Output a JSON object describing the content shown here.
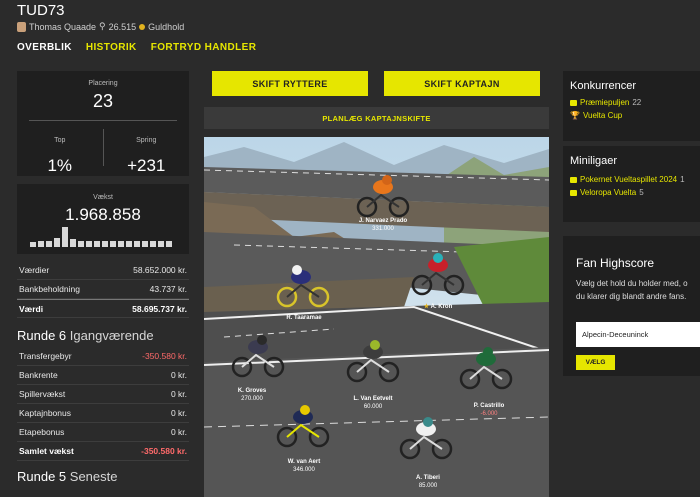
{
  "header": {
    "team_name": "TUD73",
    "manager": "Thomas Quaade",
    "points": "26.515",
    "league": "Guldhold"
  },
  "nav": {
    "items": [
      {
        "label": "OVERBLIK",
        "active": false
      },
      {
        "label": "HISTORIK",
        "active": true
      },
      {
        "label": "FORTRYD HANDLER",
        "active": true
      }
    ]
  },
  "stats": {
    "placering_label": "Placering",
    "placering": "23",
    "top_label": "Top",
    "top": "1%",
    "spring_label": "Spring",
    "spring": "+231",
    "vaekst_label": "Vækst",
    "vaekst": "1.968.858"
  },
  "values": [
    {
      "label": "Værdier",
      "value": "58.652.000 kr."
    },
    {
      "label": "Bankbeholdning",
      "value": "43.737 kr."
    },
    {
      "label": "Værdi",
      "value": "58.695.737 kr."
    }
  ],
  "round6": {
    "num": "Runde 6",
    "status": "Igangværende",
    "rows": [
      {
        "label": "Transfergebyr",
        "value": "-350.580 kr."
      },
      {
        "label": "Bankrente",
        "value": "0 kr."
      },
      {
        "label": "Spillervækst",
        "value": "0 kr."
      },
      {
        "label": "Kaptajnbonus",
        "value": "0 kr."
      },
      {
        "label": "Etapebonus",
        "value": "0 kr."
      },
      {
        "label": "Samlet vækst",
        "value": "-350.580 kr."
      }
    ]
  },
  "round5": {
    "num": "Runde 5",
    "status": "Seneste"
  },
  "actions": {
    "skift_ryttere": "SKIFT RYTTERE",
    "skift_kaptajn": "SKIFT KAPTAJN",
    "plan": "PLANLÆG KAPTAJNSKIFTE"
  },
  "riders": [
    {
      "name": "J. Narvaez Prado",
      "value": "331.000",
      "jersey": "#e8761c"
    },
    {
      "name": "R. Taaramae",
      "value": "",
      "jersey": "#2a2f7a"
    },
    {
      "name": "A. Kron",
      "value": "",
      "jersey": "#c8202a"
    },
    {
      "name": "K. Groves",
      "value": "270.000",
      "jersey": "#3b3b50"
    },
    {
      "name": "L. Van Eetvelt",
      "value": "60.000",
      "jersey": "#3d3d3d"
    },
    {
      "name": "P. Castrillo",
      "value": "-6.000",
      "jersey": "#1f6b3a"
    },
    {
      "name": "W. van Aert",
      "value": "346.000",
      "jersey": "#1f2a55"
    },
    {
      "name": "A. Tiberi",
      "value": "85.000",
      "jersey": "#f0f0f0"
    }
  ],
  "konkurrencer": {
    "title": "Konkurrencer",
    "items": [
      {
        "label": "Præmiepuljen",
        "count": "22"
      },
      {
        "label": "Vuelta Cup",
        "count": ""
      }
    ]
  },
  "miniligaer": {
    "title": "Miniligaer",
    "items": [
      {
        "label": "Pokernet Vueltaspillet 2024",
        "count": "1"
      },
      {
        "label": "Veloropa Vuelta",
        "count": "5"
      }
    ]
  },
  "fan": {
    "title": "Fan Highscore",
    "text1": "Vælg det hold du holder med, o",
    "text2": "du klarer dig blandt andre fans.",
    "selected": "Alpecin-Deceuninck",
    "button": "VÆLG"
  },
  "colors": {
    "accent": "#e6e600",
    "negative": "#ff6a6a",
    "star": "#e1b21e"
  }
}
